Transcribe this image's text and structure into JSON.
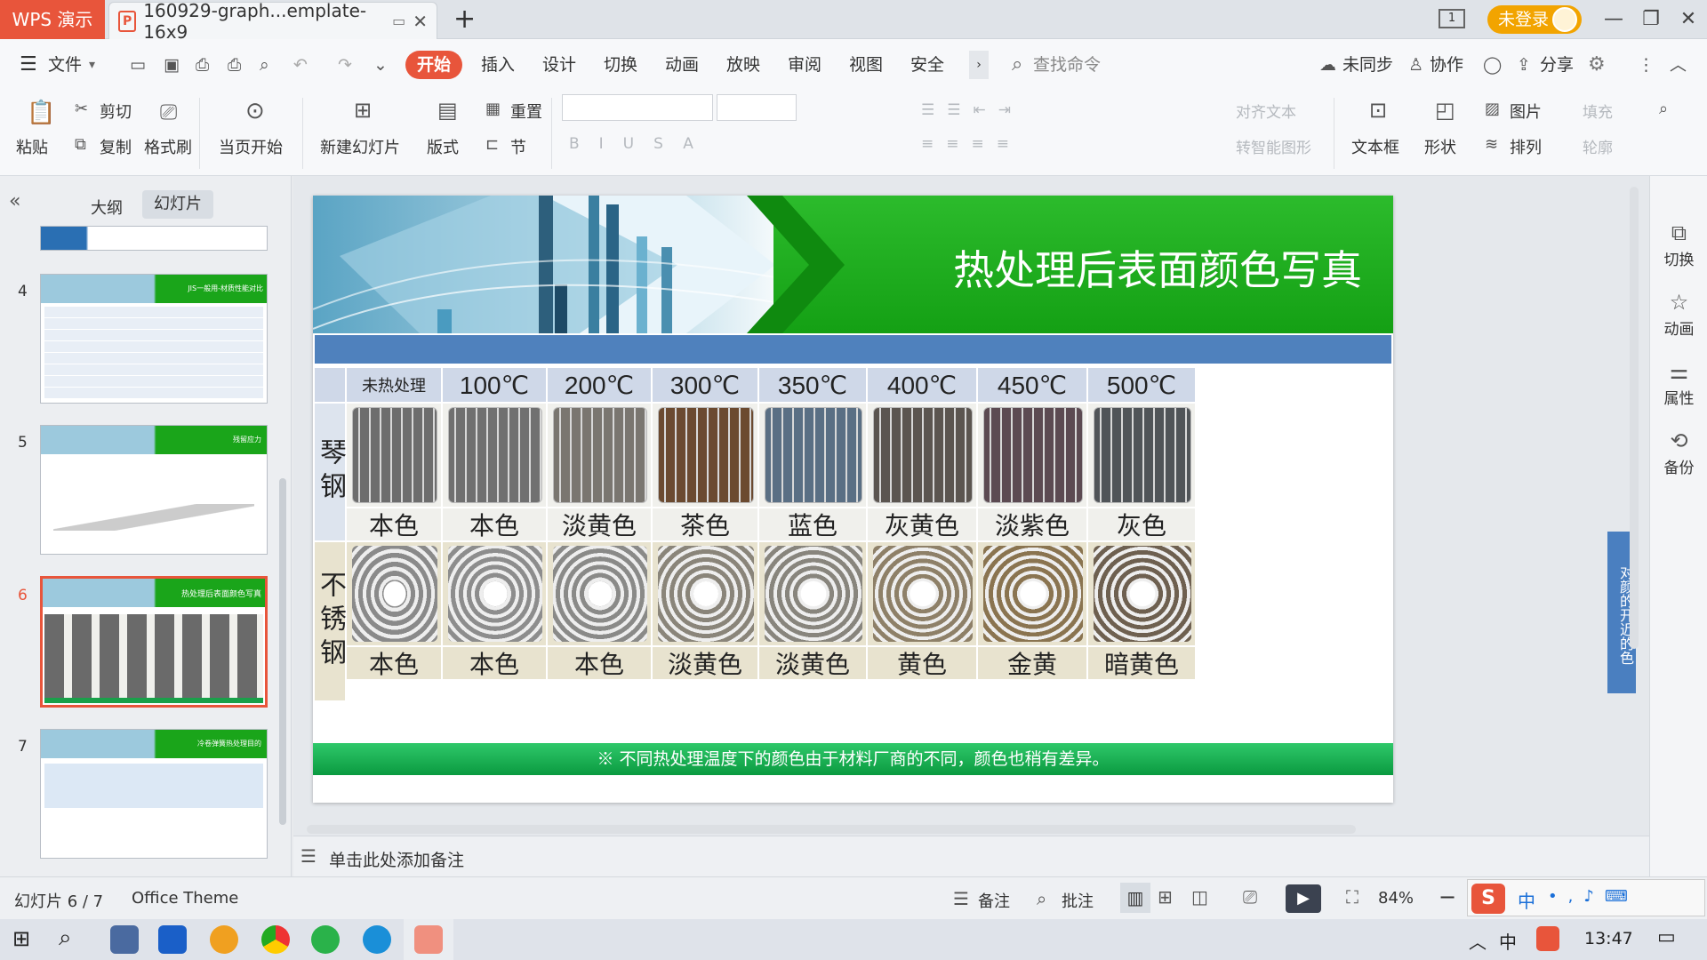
{
  "app": {
    "name": "WPS 演示",
    "doc_tab": "160929-graph...emplate-16x9",
    "login": "未登录"
  },
  "menu": {
    "file": "文件",
    "tabs": [
      "开始",
      "插入",
      "设计",
      "切换",
      "动画",
      "放映",
      "审阅",
      "视图",
      "安全"
    ],
    "search": "查找命令",
    "sync": "未同步",
    "collab": "协作",
    "share": "分享"
  },
  "ribbon": {
    "paste": "粘贴",
    "cut": "剪切",
    "copy": "复制",
    "format_painter": "格式刷",
    "from_current": "当页开始",
    "new_slide": "新建幻灯片",
    "layout": "版式",
    "reset": "重置",
    "section": "节",
    "align_text": "对齐文本",
    "smart_art": "转智能图形",
    "textbox": "文本框",
    "shape": "形状",
    "picture": "图片",
    "arrange": "排列",
    "fill": "填充",
    "outline": "轮廓"
  },
  "left_pane": {
    "tab_outline": "大纲",
    "tab_slides": "幻灯片",
    "slide_numbers": [
      "4",
      "5",
      "6",
      "7"
    ],
    "thumb_titles": [
      "JIS一般用-材质性能对比",
      "残留应力",
      "热处理后表面颜色写真",
      "冷卷弹簧热处理目的"
    ]
  },
  "slide": {
    "title": "热处理后表面颜色写真",
    "corner_label": "未热处理",
    "temperatures": [
      "100℃",
      "200℃",
      "300℃",
      "350℃",
      "400℃",
      "450℃",
      "500℃"
    ],
    "row1_label": "琴钢",
    "row1_colors": [
      "本色",
      "本色",
      "淡黄色",
      "茶色",
      "蓝色",
      "灰黄色",
      "淡紫色",
      "灰色"
    ],
    "row2_label": "不锈钢",
    "row2_colors": [
      "本色",
      "本色",
      "本色",
      "淡黄色",
      "淡黄色",
      "黄色",
      "金黄",
      "暗黄色"
    ],
    "footnote": "※  不同热处理温度下的颜色由于材料厂商的不同，颜色也稍有差异。",
    "coil_tints_row1": [
      "#6d6d6d",
      "#707070",
      "#7a7670",
      "#6b4a30",
      "#5a6f84",
      "#5b5550",
      "#5c4a52",
      "#505458"
    ],
    "coil_tints_row2": [
      "#8a8a8a",
      "#8d8d8d",
      "#8a8a88",
      "#8a857a",
      "#88857d",
      "#8e8068",
      "#8a7450",
      "#6e6050"
    ]
  },
  "notes_placeholder": "单击此处添加备注",
  "right_pane": [
    "切换",
    "动画",
    "属性",
    "备份"
  ],
  "status": {
    "slide_pos": "幻灯片 6 / 7",
    "theme": "Office Theme",
    "notes": "备注",
    "comments": "批注",
    "zoom": "84%"
  },
  "taskbar": {
    "time": "13:47",
    "ime": "中"
  }
}
